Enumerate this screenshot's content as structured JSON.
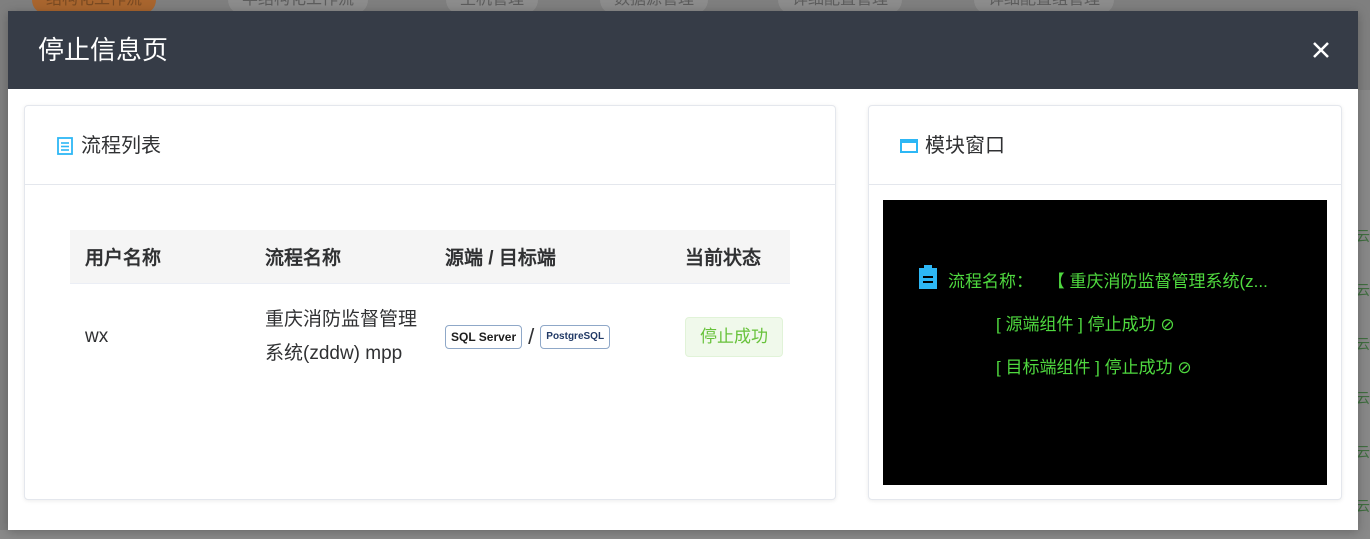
{
  "background": {
    "tabs": [
      "结构化工作流",
      "半结构化工作流",
      "主机管理",
      "数据源管理",
      "详细配置管理",
      "详细配置组管理"
    ],
    "right_cells": [
      "云",
      "云",
      "云",
      "云",
      "云",
      "云",
      "云"
    ]
  },
  "modal": {
    "title": "停止信息页",
    "close_icon": "close-icon"
  },
  "left_panel": {
    "title": "流程列表",
    "icon": "document-icon",
    "columns": [
      "用户名称",
      "流程名称",
      "源端 / 目标端",
      "当前状态"
    ],
    "rows": [
      {
        "user": "wx",
        "process": "重庆消防监督管理系统(zddw) mpp",
        "source_logo": "SQL Server",
        "separator": "/",
        "target_logo": "PostgreSQL",
        "status": "停止成功"
      }
    ]
  },
  "right_panel": {
    "title": "模块窗口",
    "icon": "window-icon",
    "console": {
      "line1_label": "流程名称：",
      "line1_value": "【 重庆消防监督管理系统(z...",
      "line2": "[ 源端组件 ] 停止成功 ⊘",
      "line3": "[ 目标端组件 ] 停止成功 ⊘"
    }
  }
}
